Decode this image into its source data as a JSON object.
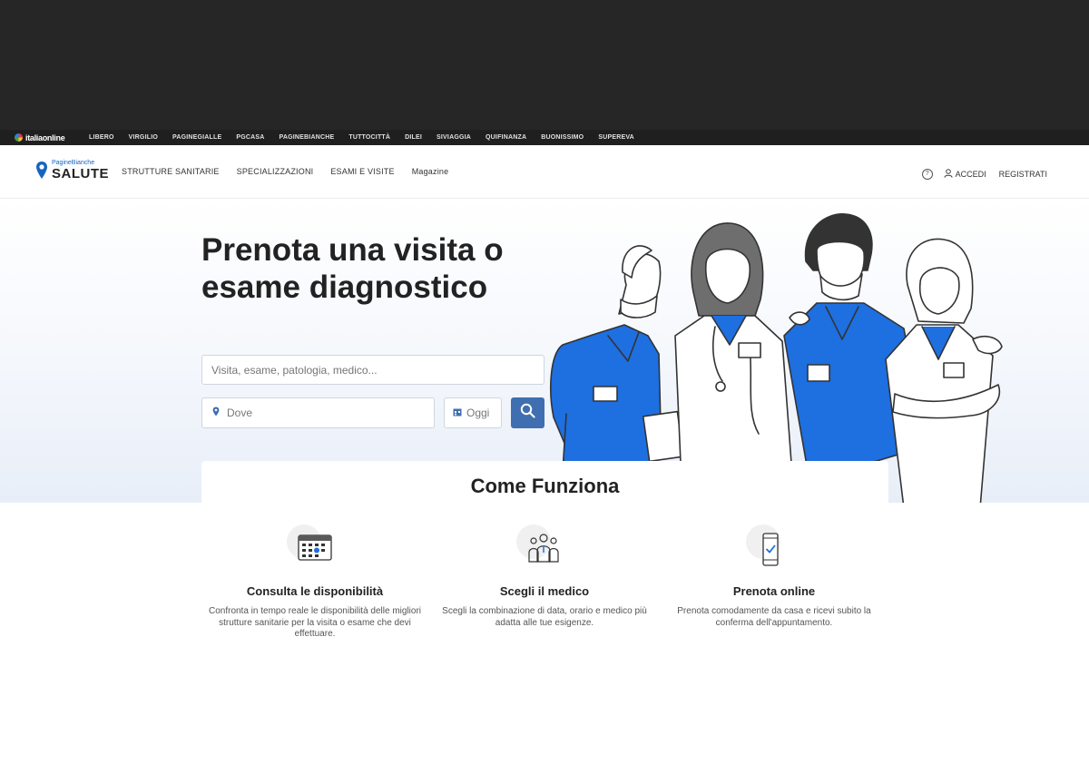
{
  "topbar": {
    "logo": "italiaonline",
    "links": [
      "LIBERO",
      "VIRGILIO",
      "PAGINEGIALLE",
      "PGCASA",
      "PAGINEBIANCHE",
      "TUTTOCITTÀ",
      "DILEI",
      "SIVIAGGIA",
      "QUIFINANZA",
      "BUONISSIMO",
      "SUPEREVA"
    ]
  },
  "navbar": {
    "brand_small": "PagineBianche",
    "brand_big": "SALUTE",
    "links": [
      "STRUTTURE SANITARIE",
      "SPECIALIZZAZIONI",
      "ESAMI E VISITE",
      "Magazine"
    ],
    "help_icon": "?",
    "login": "ACCEDI",
    "register": "REGISTRATI"
  },
  "hero": {
    "title": "Prenota una visita o esame diagnostico",
    "search_placeholder": "Visita, esame, patologia, medico...",
    "where_placeholder": "Dove",
    "date_label": "Oggi"
  },
  "how": {
    "title": "Come Funziona",
    "steps": [
      {
        "icon": "calendar-icon",
        "title": "Consulta le disponibilità",
        "desc": "Confronta in tempo reale le disponibilità delle migliori strutture sanitarie per la visita o esame che devi effettuare."
      },
      {
        "icon": "doctors-icon",
        "title": "Scegli il medico",
        "desc": "Scegli la combinazione di data, orario e medico più adatta alle tue esigenze."
      },
      {
        "icon": "phone-check-icon",
        "title": "Prenota online",
        "desc": "Prenota comodamente da casa e ricevi subito la conferma dell'appuntamento."
      }
    ]
  },
  "colors": {
    "accent": "#1565c0",
    "scrubs": "#1e6fe0",
    "button": "#3f6fb1",
    "dark_top": "#262626"
  }
}
